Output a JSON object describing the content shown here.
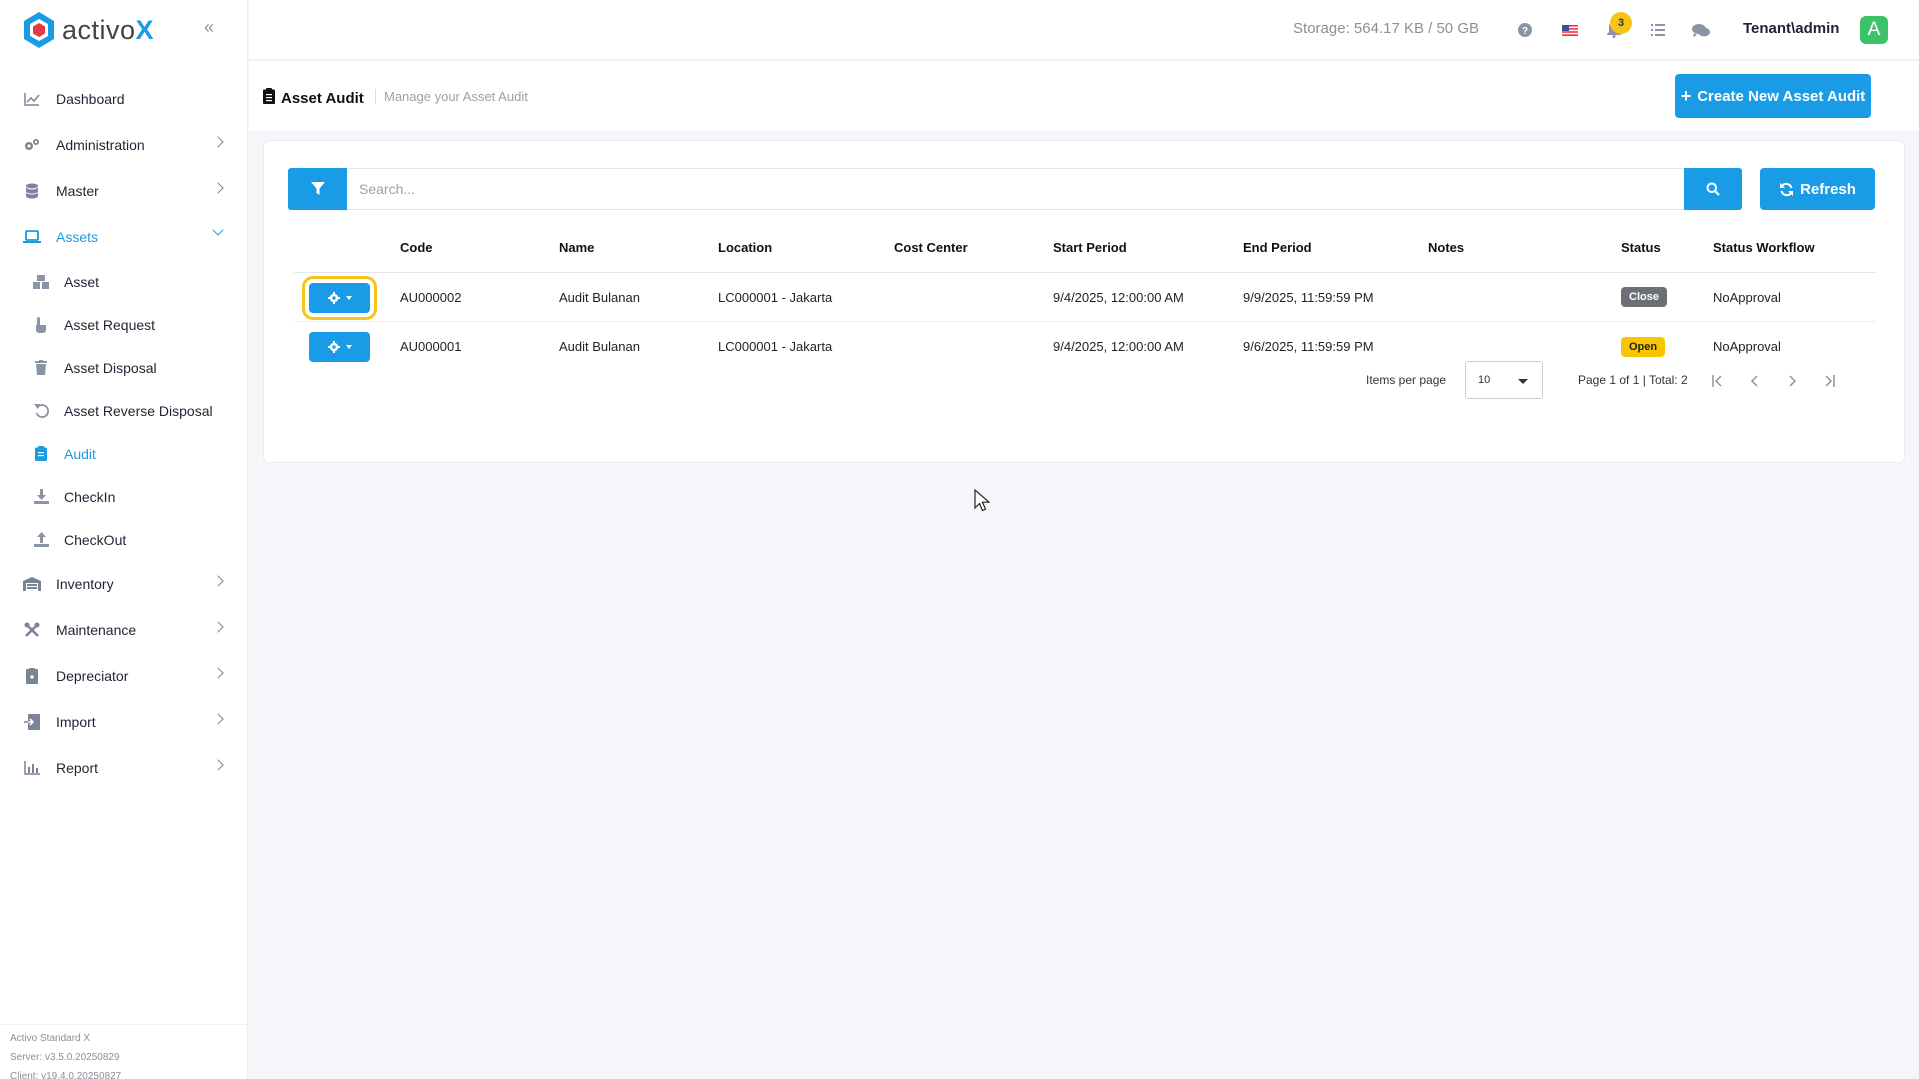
{
  "app": {
    "logo_main": "activo",
    "logo_accent": "X"
  },
  "sidebar": {
    "items": [
      {
        "label": "Dashboard",
        "icon": "chart-line-icon",
        "has_children": false
      },
      {
        "label": "Administration",
        "icon": "cogs-icon",
        "has_children": true
      },
      {
        "label": "Master",
        "icon": "database-icon",
        "has_children": true
      },
      {
        "label": "Assets",
        "icon": "laptop-icon",
        "has_children": true,
        "open": true
      },
      {
        "label": "Inventory",
        "icon": "warehouse-icon",
        "has_children": true
      },
      {
        "label": "Maintenance",
        "icon": "tools-icon",
        "has_children": true
      },
      {
        "label": "Depreciator",
        "icon": "calculator-icon",
        "has_children": true
      },
      {
        "label": "Import",
        "icon": "import-icon",
        "has_children": true
      },
      {
        "label": "Report",
        "icon": "bar-chart-icon",
        "has_children": true
      }
    ],
    "assets_children": [
      {
        "label": "Asset",
        "icon": "boxes-icon"
      },
      {
        "label": "Asset Request",
        "icon": "hand-pointer-icon"
      },
      {
        "label": "Asset Disposal",
        "icon": "trash-icon"
      },
      {
        "label": "Asset Reverse Disposal",
        "icon": "undo-icon"
      },
      {
        "label": "Audit",
        "icon": "clipboard-icon",
        "active": true
      },
      {
        "label": "CheckIn",
        "icon": "download-icon"
      },
      {
        "label": "CheckOut",
        "icon": "upload-icon"
      }
    ],
    "version": {
      "edition": "Activo Standard X",
      "server": "Server: v3.5.0.20250829",
      "client": "Client: v19.4.0.20250827"
    }
  },
  "header": {
    "storage": "Storage: 564.17 KB / 50 GB",
    "notification_count": "3",
    "user": "Tenant\\admin",
    "avatar_letter": "A"
  },
  "page": {
    "title": "Asset Audit",
    "subtitle": "Manage your Asset Audit",
    "create_button": "Create New Asset Audit"
  },
  "toolbar": {
    "search_placeholder": "Search...",
    "refresh_label": "Refresh"
  },
  "table": {
    "columns": [
      "",
      "Code",
      "Name",
      "Location",
      "Cost Center",
      "Start Period",
      "End Period",
      "Notes",
      "Status",
      "Status Workflow"
    ],
    "rows": [
      {
        "code": "AU000002",
        "name": "Audit Bulanan",
        "location": "LC000001 - Jakarta",
        "cost_center": "",
        "start": "9/4/2025, 12:00:00 AM",
        "end": "9/9/2025, 11:59:59 PM",
        "notes": "",
        "status": "Close",
        "workflow": "NoApproval"
      },
      {
        "code": "AU000001",
        "name": "Audit Bulanan",
        "location": "LC000001 - Jakarta",
        "cost_center": "",
        "start": "9/4/2025, 12:00:00 AM",
        "end": "9/6/2025, 11:59:59 PM",
        "notes": "",
        "status": "Open",
        "workflow": "NoApproval"
      }
    ]
  },
  "pagination": {
    "items_per_page_label": "Items per page",
    "items_per_page": "10",
    "page_info": "Page 1 of 1 | Total: 2"
  },
  "colors": {
    "accent": "#1a9be6",
    "status_close": "#6c6f75",
    "status_open": "#f7c600",
    "avatar": "#3cc36a"
  }
}
